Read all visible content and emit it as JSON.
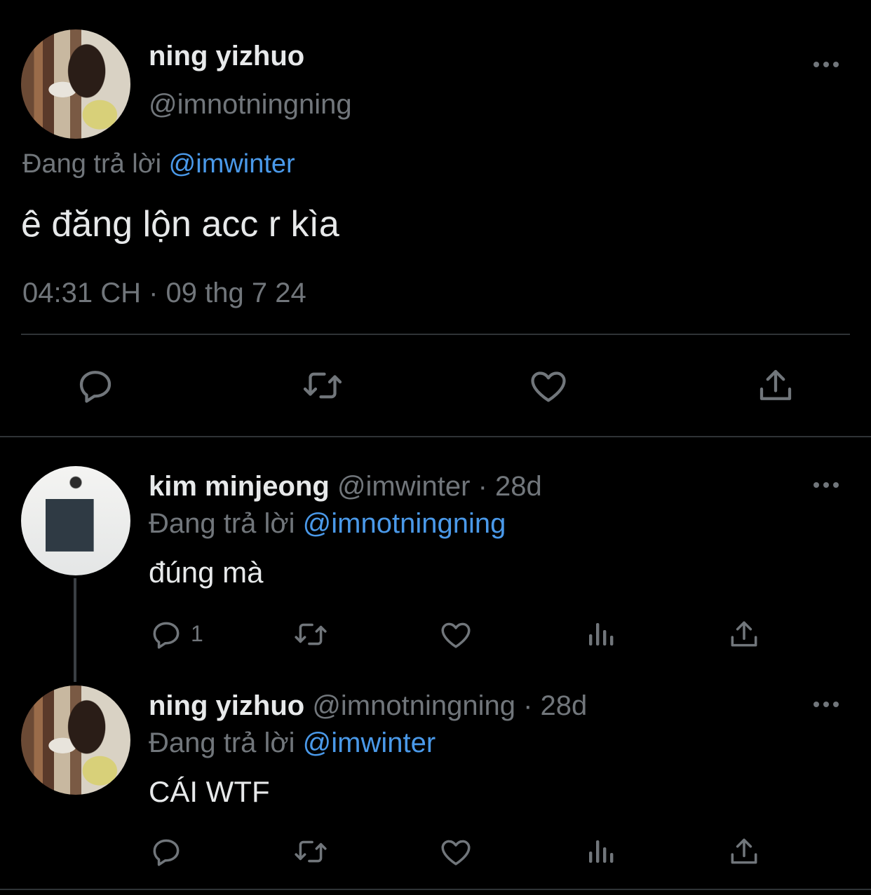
{
  "main_tweet": {
    "name": "ning yizhuo",
    "handle": "@imnotningning",
    "replying_label": "Đang trả lời",
    "replying_to": "@imwinter",
    "text": "ê đăng lộn acc r kìa",
    "timestamp": "04:31 CH · 09 thg 7 24"
  },
  "replies": [
    {
      "name": "kim minjeong",
      "handle_time": "@imwinter · 28d",
      "replying_label": "Đang trả lời",
      "replying_to": "@imnotningning",
      "text": "đúng mà",
      "reply_count": "1"
    },
    {
      "name": "ning yizhuo",
      "handle_time": "@imnotningning · 28d",
      "replying_label": "Đang trả lời",
      "replying_to": "@imwinter",
      "text": "CÁI WTF",
      "reply_count": ""
    }
  ],
  "colors": {
    "background": "#000000",
    "text": "#e7e9ea",
    "secondary": "#71767b",
    "link": "#4a99e9",
    "divider": "#2f3336"
  },
  "icons": [
    "reply-icon",
    "retweet-icon",
    "like-icon",
    "views-icon",
    "share-icon",
    "more-icon"
  ]
}
